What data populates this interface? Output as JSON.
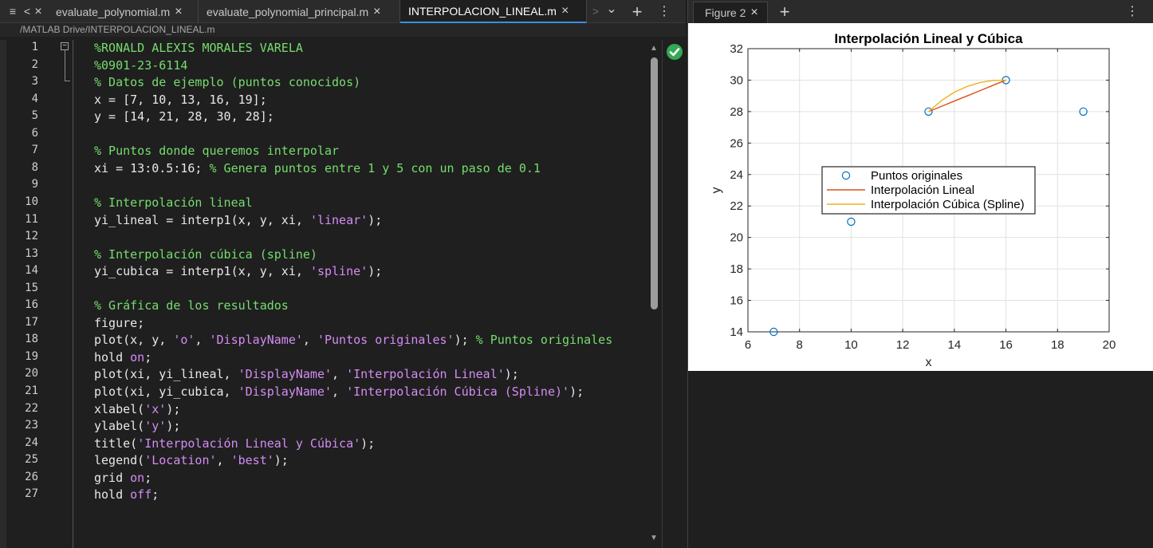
{
  "tabs": {
    "items": [
      {
        "label": "evaluate_polynomial.m"
      },
      {
        "label": "evaluate_polynomial_principal.m"
      },
      {
        "label": "INTERPOLACION_LINEAL.m"
      }
    ],
    "close_glyph": "×",
    "add_glyph": "+",
    "menu_glyph": "⋮",
    "scroll_left_glyph": "<",
    "scroll_right_glyph": ">",
    "overflow_glyph": "⌄",
    "list_glyph": "≡"
  },
  "path": "/MATLAB Drive/INTERPOLACION_LINEAL.m",
  "editor": {
    "line_numbers": [
      "1",
      "2",
      "3",
      "4",
      "5",
      "6",
      "7",
      "8",
      "9",
      "10",
      "11",
      "12",
      "13",
      "14",
      "15",
      "16",
      "17",
      "18",
      "19",
      "20",
      "21",
      "22",
      "23",
      "24",
      "25",
      "26",
      "27"
    ],
    "lines": [
      [
        {
          "t": "%RONALD ALEXIS MORALES VARELA",
          "c": "com"
        }
      ],
      [
        {
          "t": "%0901-23-6114",
          "c": "com"
        }
      ],
      [
        {
          "t": "% Datos de ejemplo (puntos conocidos)",
          "c": "com"
        }
      ],
      [
        {
          "t": "x = [7, 10, 13, 16, 19];",
          "c": "txt"
        }
      ],
      [
        {
          "t": "y = [14, 21, 28, 30, 28];",
          "c": "txt"
        }
      ],
      [],
      [
        {
          "t": "% Puntos donde queremos interpolar",
          "c": "com"
        }
      ],
      [
        {
          "t": "xi = 13:0.5:16; ",
          "c": "txt"
        },
        {
          "t": "% Genera puntos entre 1 y 5 con un paso de 0.1",
          "c": "com"
        }
      ],
      [],
      [
        {
          "t": "% Interpolación lineal",
          "c": "com"
        }
      ],
      [
        {
          "t": "yi_lineal = interp1(x, y, xi, ",
          "c": "txt"
        },
        {
          "t": "'linear'",
          "c": "str"
        },
        {
          "t": ");",
          "c": "txt"
        }
      ],
      [],
      [
        {
          "t": "% Interpolación cúbica (spline)",
          "c": "com"
        }
      ],
      [
        {
          "t": "yi_cubica = interp1(x, y, xi, ",
          "c": "txt"
        },
        {
          "t": "'spline'",
          "c": "str"
        },
        {
          "t": ");",
          "c": "txt"
        }
      ],
      [],
      [
        {
          "t": "% Gráfica de los resultados",
          "c": "com"
        }
      ],
      [
        {
          "t": "figure;",
          "c": "txt"
        }
      ],
      [
        {
          "t": "plot(x, y, ",
          "c": "txt"
        },
        {
          "t": "'o'",
          "c": "str"
        },
        {
          "t": ", ",
          "c": "txt"
        },
        {
          "t": "'DisplayName'",
          "c": "str"
        },
        {
          "t": ", ",
          "c": "txt"
        },
        {
          "t": "'Puntos originales'",
          "c": "str"
        },
        {
          "t": "); ",
          "c": "txt"
        },
        {
          "t": "% Puntos originales",
          "c": "com"
        }
      ],
      [
        {
          "t": "hold ",
          "c": "txt"
        },
        {
          "t": "on",
          "c": "kw"
        },
        {
          "t": ";",
          "c": "txt"
        }
      ],
      [
        {
          "t": "plot(xi, yi_lineal, ",
          "c": "txt"
        },
        {
          "t": "'DisplayName'",
          "c": "str"
        },
        {
          "t": ", ",
          "c": "txt"
        },
        {
          "t": "'Interpolación Lineal'",
          "c": "str"
        },
        {
          "t": ");",
          "c": "txt"
        }
      ],
      [
        {
          "t": "plot(xi, yi_cubica, ",
          "c": "txt"
        },
        {
          "t": "'DisplayName'",
          "c": "str"
        },
        {
          "t": ", ",
          "c": "txt"
        },
        {
          "t": "'Interpolación Cúbica (Spline)'",
          "c": "str"
        },
        {
          "t": ");",
          "c": "txt"
        }
      ],
      [
        {
          "t": "xlabel(",
          "c": "txt"
        },
        {
          "t": "'x'",
          "c": "str"
        },
        {
          "t": ");",
          "c": "txt"
        }
      ],
      [
        {
          "t": "ylabel(",
          "c": "txt"
        },
        {
          "t": "'y'",
          "c": "str"
        },
        {
          "t": ");",
          "c": "txt"
        }
      ],
      [
        {
          "t": "title(",
          "c": "txt"
        },
        {
          "t": "'Interpolación Lineal y Cúbica'",
          "c": "str"
        },
        {
          "t": ");",
          "c": "txt"
        }
      ],
      [
        {
          "t": "legend(",
          "c": "txt"
        },
        {
          "t": "'Location'",
          "c": "str"
        },
        {
          "t": ", ",
          "c": "txt"
        },
        {
          "t": "'best'",
          "c": "str"
        },
        {
          "t": ");",
          "c": "txt"
        }
      ],
      [
        {
          "t": "grid ",
          "c": "txt"
        },
        {
          "t": "on",
          "c": "kw"
        },
        {
          "t": ";",
          "c": "txt"
        }
      ],
      [
        {
          "t": "hold ",
          "c": "txt"
        },
        {
          "t": "off",
          "c": "kw"
        },
        {
          "t": ";",
          "c": "txt"
        }
      ]
    ],
    "fold_glyph": "−",
    "status_icon": "check-circle-icon"
  },
  "figure": {
    "tab_label": "Figure 2",
    "close_glyph": "×",
    "add_glyph": "+",
    "menu_glyph": "⋮"
  },
  "chart_data": {
    "type": "line",
    "title": "Interpolación Lineal y Cúbica",
    "xlabel": "x",
    "ylabel": "y",
    "xlim": [
      6,
      20
    ],
    "ylim": [
      14,
      32
    ],
    "xticks": [
      6,
      8,
      10,
      12,
      14,
      16,
      18,
      20
    ],
    "yticks": [
      14,
      16,
      18,
      20,
      22,
      24,
      26,
      28,
      30,
      32
    ],
    "grid": true,
    "legend_location": "center-left",
    "series": [
      {
        "name": "Puntos originales",
        "style": "marker-o",
        "color": "#0072bd",
        "x": [
          7,
          10,
          13,
          16,
          19
        ],
        "y": [
          14,
          21,
          28,
          30,
          28
        ]
      },
      {
        "name": "Interpolación Lineal",
        "style": "line",
        "color": "#d95319",
        "x": [
          13,
          13.5,
          14,
          14.5,
          15,
          15.5,
          16
        ],
        "y": [
          28,
          28.33,
          28.67,
          29,
          29.33,
          29.67,
          30
        ]
      },
      {
        "name": "Interpolación Cúbica (Spline)",
        "style": "line",
        "color": "#edb120",
        "x": [
          13,
          13.5,
          14,
          14.5,
          15,
          15.5,
          16
        ],
        "y": [
          28,
          28.7,
          29.23,
          29.6,
          29.85,
          29.98,
          30
        ]
      }
    ]
  }
}
